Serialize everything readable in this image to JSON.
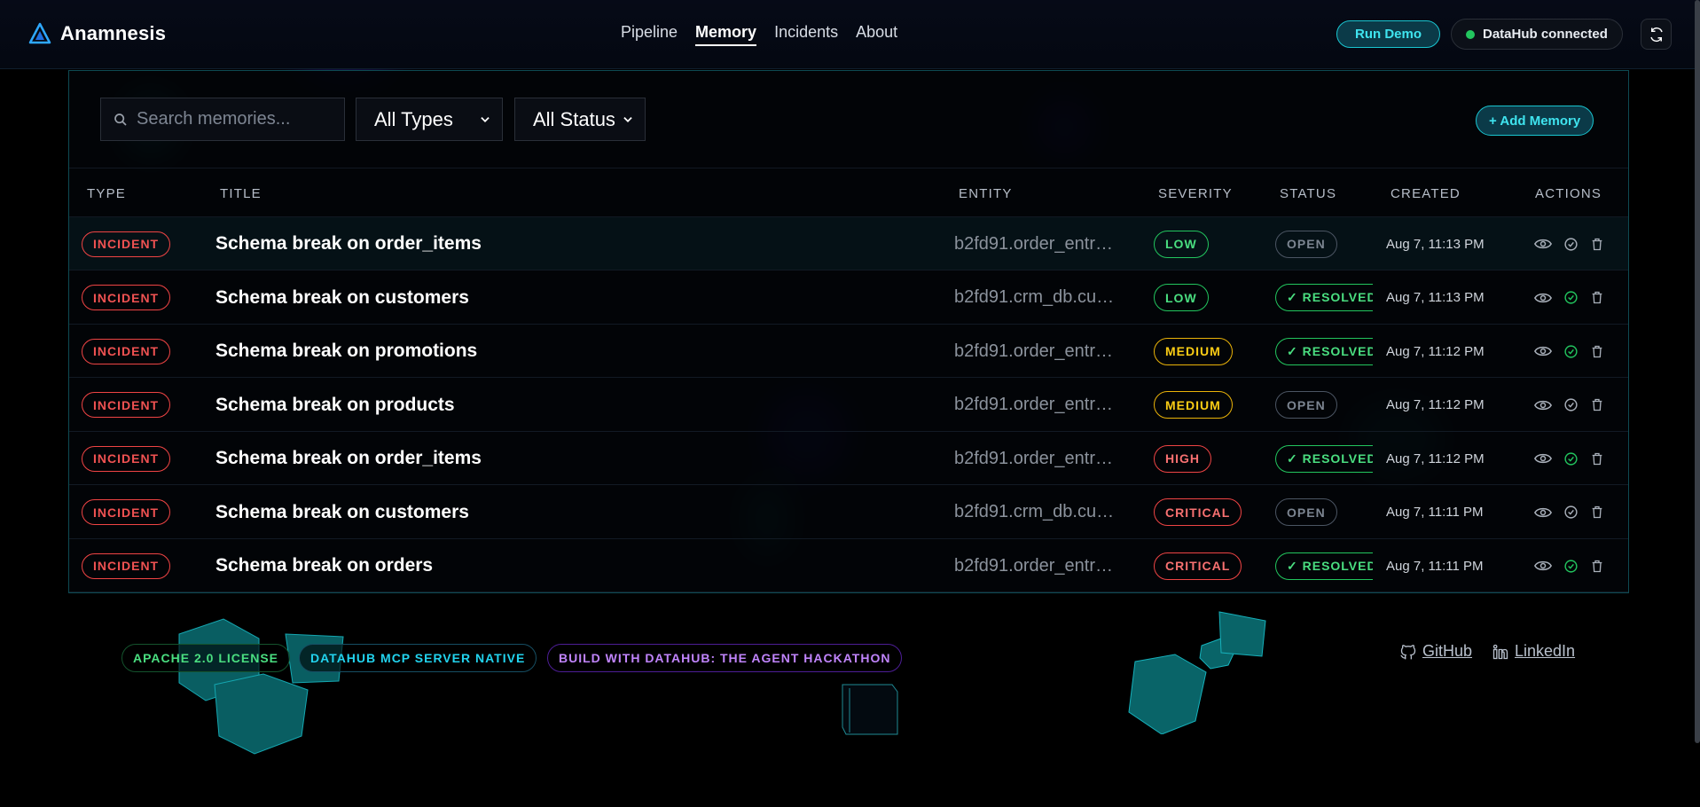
{
  "app": {
    "name": "Anamnesis"
  },
  "nav": {
    "items": [
      "Pipeline",
      "Memory",
      "Incidents",
      "About"
    ],
    "active": "Memory"
  },
  "header": {
    "run_demo_label": "Run Demo",
    "connection_label": "DataHub connected",
    "connection_color": "#22c55e"
  },
  "toolbar": {
    "search_placeholder": "Search memories...",
    "type_filter": "All Types",
    "status_filter": "All Status",
    "add_label": "+ Add Memory"
  },
  "table": {
    "columns": [
      "TYPE",
      "TITLE",
      "ENTITY",
      "SEVERITY",
      "STATUS",
      "CREATED",
      "ACTIONS"
    ],
    "rows": [
      {
        "type": "INCIDENT",
        "title": "Schema break on order_items",
        "entity": "b2fd91.order_entr…",
        "severity": "LOW",
        "severity_class": "low",
        "status": "OPEN",
        "status_class": "open",
        "created": "Aug 7, 11:13 PM"
      },
      {
        "type": "INCIDENT",
        "title": "Schema break on customers",
        "entity": "b2fd91.crm_db.cu…",
        "severity": "LOW",
        "severity_class": "low",
        "status": "✓ RESOLVED",
        "status_class": "resolved",
        "created": "Aug 7, 11:13 PM"
      },
      {
        "type": "INCIDENT",
        "title": "Schema break on promotions",
        "entity": "b2fd91.order_entr…",
        "severity": "MEDIUM",
        "severity_class": "medium",
        "status": "✓ RESOLVED",
        "status_class": "resolved",
        "created": "Aug 7, 11:12 PM"
      },
      {
        "type": "INCIDENT",
        "title": "Schema break on products",
        "entity": "b2fd91.order_entr…",
        "severity": "MEDIUM",
        "severity_class": "medium",
        "status": "OPEN",
        "status_class": "open",
        "created": "Aug 7, 11:12 PM"
      },
      {
        "type": "INCIDENT",
        "title": "Schema break on order_items",
        "entity": "b2fd91.order_entr…",
        "severity": "HIGH",
        "severity_class": "high",
        "status": "✓ RESOLVED",
        "status_class": "resolved",
        "created": "Aug 7, 11:12 PM"
      },
      {
        "type": "INCIDENT",
        "title": "Schema break on customers",
        "entity": "b2fd91.crm_db.cu…",
        "severity": "CRITICAL",
        "severity_class": "critical",
        "status": "OPEN",
        "status_class": "open",
        "created": "Aug 7, 11:11 PM"
      },
      {
        "type": "INCIDENT",
        "title": "Schema break on orders",
        "entity": "b2fd91.order_entr…",
        "severity": "CRITICAL",
        "severity_class": "critical",
        "status": "✓ RESOLVED",
        "status_class": "resolved",
        "created": "Aug 7, 11:11 PM"
      }
    ]
  },
  "footer": {
    "badges": [
      {
        "label": "APACHE 2.0 LICENSE",
        "color": "#22c55e"
      },
      {
        "label": "DATAHUB MCP SERVER NATIVE",
        "color": "#22d3ee"
      },
      {
        "label": "BUILD WITH DATAHUB: THE AGENT HACKATHON",
        "color": "#c084fc"
      }
    ],
    "links": [
      "GitHub",
      "LinkedIn"
    ]
  }
}
